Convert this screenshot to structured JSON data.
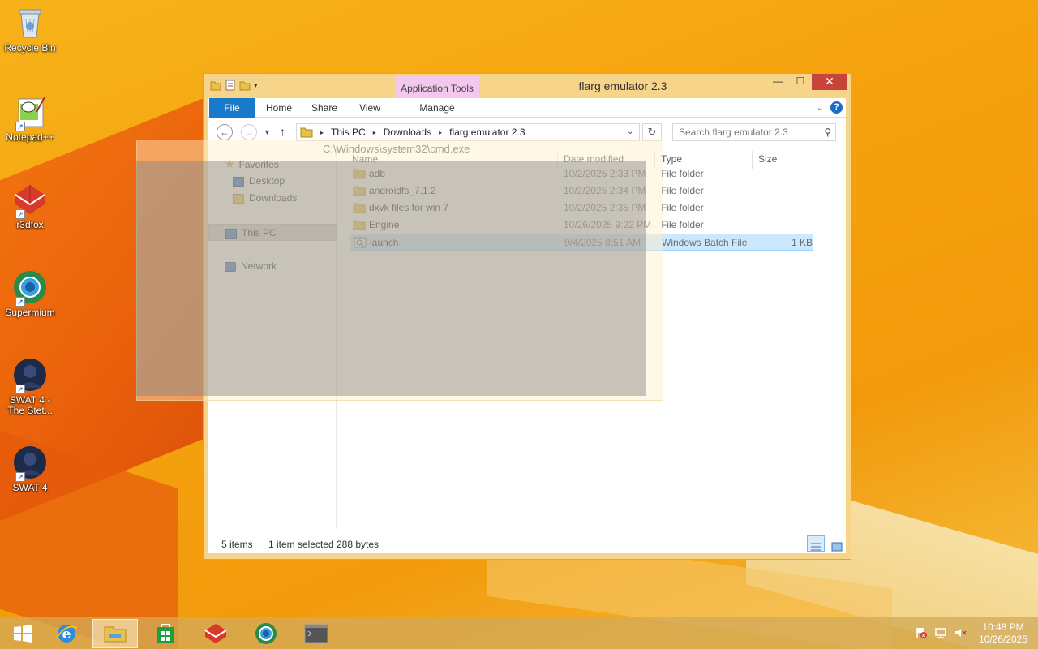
{
  "desktop": {
    "icons": [
      {
        "label": "Recycle Bin"
      },
      {
        "label": "Notepad++"
      },
      {
        "label": "r3dfox"
      },
      {
        "label": "Supermium"
      },
      {
        "label": "SWAT 4 - The Stet..."
      },
      {
        "label": "SWAT 4"
      }
    ]
  },
  "window": {
    "title": "flarg emulator 2.3",
    "context_tab": "Application Tools",
    "tabs": [
      "File",
      "Home",
      "Share",
      "View",
      "Manage"
    ],
    "ghost_title": "C:\\Windows\\system32\\cmd.exe"
  },
  "address": {
    "crumbs": [
      "This PC",
      "Downloads",
      "flarg emulator 2.3"
    ],
    "search_placeholder": "Search flarg emulator 2.3"
  },
  "nav": {
    "favorites": "Favorites",
    "desktop": "Desktop",
    "downloads": "Downloads",
    "this_pc": "This PC",
    "network": "Network"
  },
  "columns": {
    "name": "Name",
    "date": "Date modified",
    "type": "Type",
    "size": "Size"
  },
  "files": [
    {
      "name": "adb",
      "date": "10/2/2025 2:33 PM",
      "type": "File folder",
      "size": ""
    },
    {
      "name": "androidfs_7.1.2",
      "date": "10/2/2025 2:34 PM",
      "type": "File folder",
      "size": ""
    },
    {
      "name": "dxvk files for win 7",
      "date": "10/2/2025 2:35 PM",
      "type": "File folder",
      "size": ""
    },
    {
      "name": "Engine",
      "date": "10/26/2025 9:22 PM",
      "type": "File folder",
      "size": ""
    },
    {
      "name": "launch",
      "date": "9/4/2025 8:51 AM",
      "type": "Windows Batch File",
      "size": "1 KB"
    }
  ],
  "status": {
    "items": "5 items",
    "selected": "1 item selected",
    "bytes": "288 bytes"
  },
  "taskbar": {
    "time": "10:48 PM",
    "date": "10/26/2025"
  },
  "colors": {
    "accent": "#1979ca",
    "close": "#c7443a",
    "selection": "#cce8ff",
    "desktop": "#f5a20e"
  }
}
